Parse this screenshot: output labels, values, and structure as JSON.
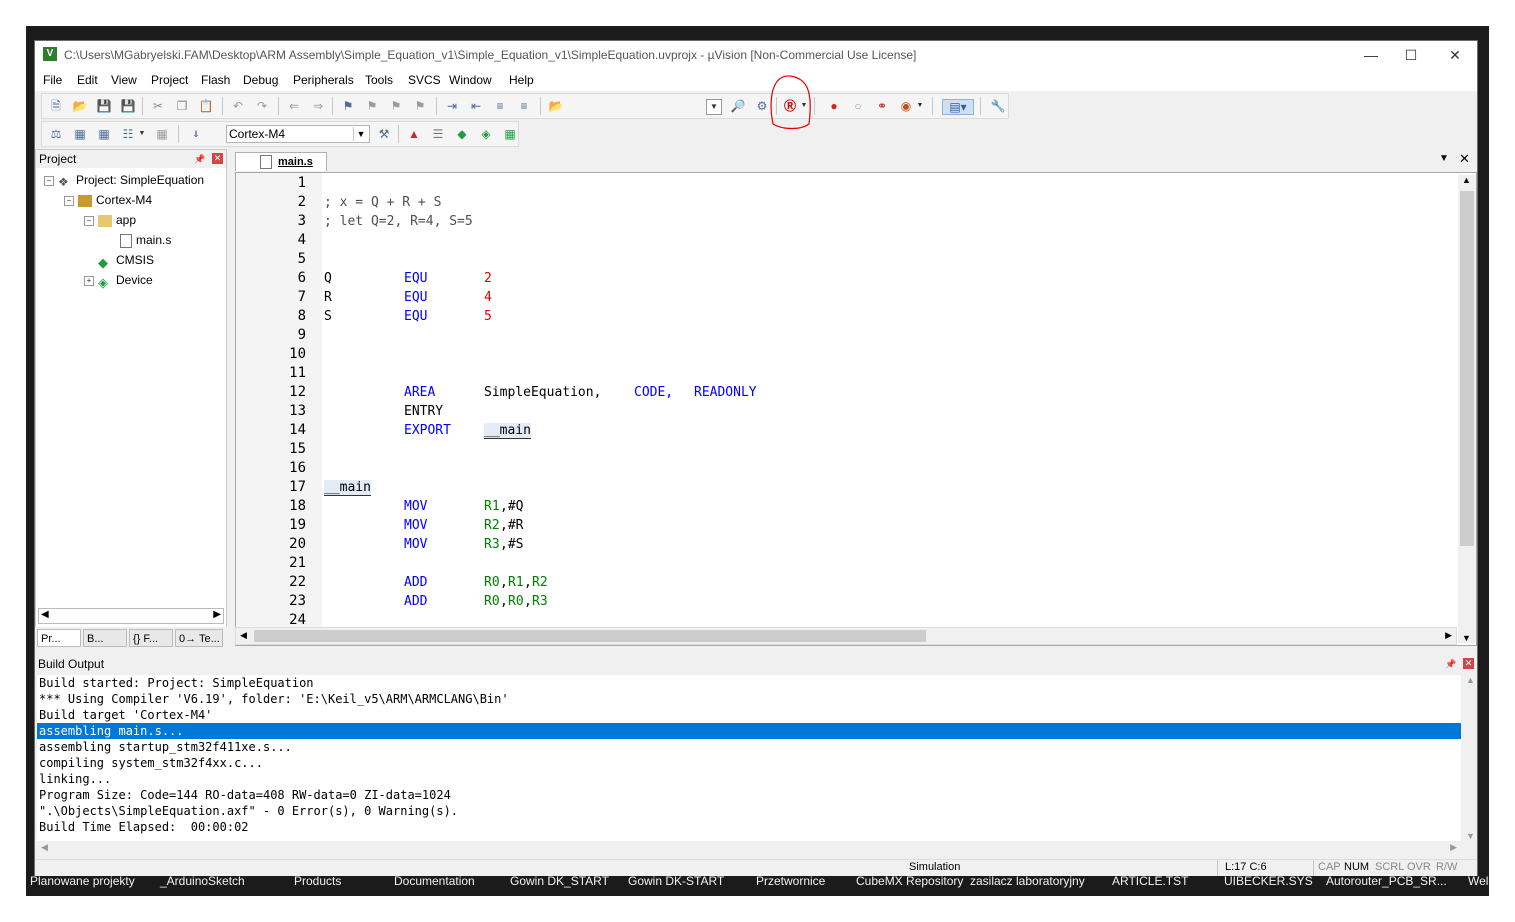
{
  "window": {
    "title": "C:\\Users\\MGabryelski.FAM\\Desktop\\ARM Assembly\\Simple_Equation_v1\\Simple_Equation_v1\\SimpleEquation.uvprojx - µVision  [Non-Commercial Use License]",
    "app_icon": "V"
  },
  "menu": [
    "File",
    "Edit",
    "View",
    "Project",
    "Flash",
    "Debug",
    "Peripherals",
    "Tools",
    "SVCS",
    "Window",
    "Help"
  ],
  "toolbar": {
    "target_select": "Cortex-M4"
  },
  "project_panel": {
    "header": "Project",
    "tree": [
      {
        "label": "Project: SimpleEquation",
        "icon": "project-icon"
      },
      {
        "label": "Cortex-M4",
        "icon": "target-folder-icon"
      },
      {
        "label": "app",
        "icon": "folder-icon"
      },
      {
        "label": "main.s",
        "icon": "file-icon"
      },
      {
        "label": "CMSIS",
        "icon": "cmsis-component-icon"
      },
      {
        "label": "Device",
        "icon": "device-component-icon"
      }
    ],
    "tabs": [
      "Pr...",
      "B...",
      "{} F...",
      "0→ Te..."
    ]
  },
  "editor": {
    "tab_label": "main.s",
    "line_numbers": [
      "1",
      "2",
      "3",
      "4",
      "5",
      "6",
      "7",
      "8",
      "9",
      "10",
      "11",
      "12",
      "13",
      "14",
      "15",
      "16",
      "17",
      "18",
      "19",
      "20",
      "21",
      "22",
      "23",
      "24"
    ],
    "code": {
      "l2": "; x = Q + R + S",
      "l3": "; let Q=2, R=4, S=5",
      "l6_label": "Q",
      "l6_op": "EQU",
      "l6_val": "2",
      "l7_label": "R",
      "l7_op": "EQU",
      "l7_val": "4",
      "l8_label": "S",
      "l8_op": "EQU",
      "l8_val": "5",
      "l12_op": "AREA",
      "l12_name": "SimpleEquation,",
      "l12_code": "CODE,",
      "l12_ro": "READONLY",
      "l13_op": "ENTRY",
      "l14_op": "EXPORT",
      "l14_sym": "__main",
      "l17_label": "__main",
      "l18_op": "MOV",
      "l18_reg": "R1",
      "l18_rest": ",#Q",
      "l19_op": "MOV",
      "l19_reg": "R2",
      "l19_rest": ",#R",
      "l20_op": "MOV",
      "l20_reg": "R3",
      "l20_rest": ",#S",
      "l22_op": "ADD",
      "l22_r0": "R0",
      "l22_r1": "R1",
      "l22_r2": "R2",
      "l23_op": "ADD",
      "l23_r0": "R0",
      "l23_r1": "R0",
      "l23_r2": "R3"
    }
  },
  "build_output": {
    "header": "Build Output",
    "lines": [
      "Build started: Project: SimpleEquation",
      "*** Using Compiler 'V6.19', folder: 'E:\\Keil_v5\\ARM\\ARMCLANG\\Bin'",
      "Build target 'Cortex-M4'",
      "assembling main.s...",
      "assembling startup_stm32f411xe.s...",
      "compiling system_stm32f4xx.c...",
      "linking...",
      "Program Size: Code=144 RO-data=408 RW-data=0 ZI-data=1024",
      "\".\\Objects\\SimpleEquation.axf\" - 0 Error(s), 0 Warning(s).",
      "Build Time Elapsed:  00:00:02"
    ],
    "selected_index": 3
  },
  "statusbar": {
    "mode": "Simulation",
    "position": "L:17 C:6",
    "indicators": [
      "CAP",
      "NUM",
      "SCRL",
      "OVR",
      "R/W"
    ]
  },
  "desktop_labels": [
    "Planowane projekty",
    "_ArduinoSketch",
    "Products",
    "Documentation",
    "Gowin DK_START",
    "Gowin DK-START",
    "Przetwornice",
    "CubeMX Repository",
    "zasilacz laboratoryjny",
    "ARTICLE.TST",
    "UIBECKER.SYS",
    "Autorouter_PCB_SR...",
    "Wel"
  ],
  "colors": {
    "selection": "#0078d7",
    "keyword": "#0000ff",
    "number": "#e00000",
    "register": "#008000",
    "annotation": "#e00000"
  }
}
